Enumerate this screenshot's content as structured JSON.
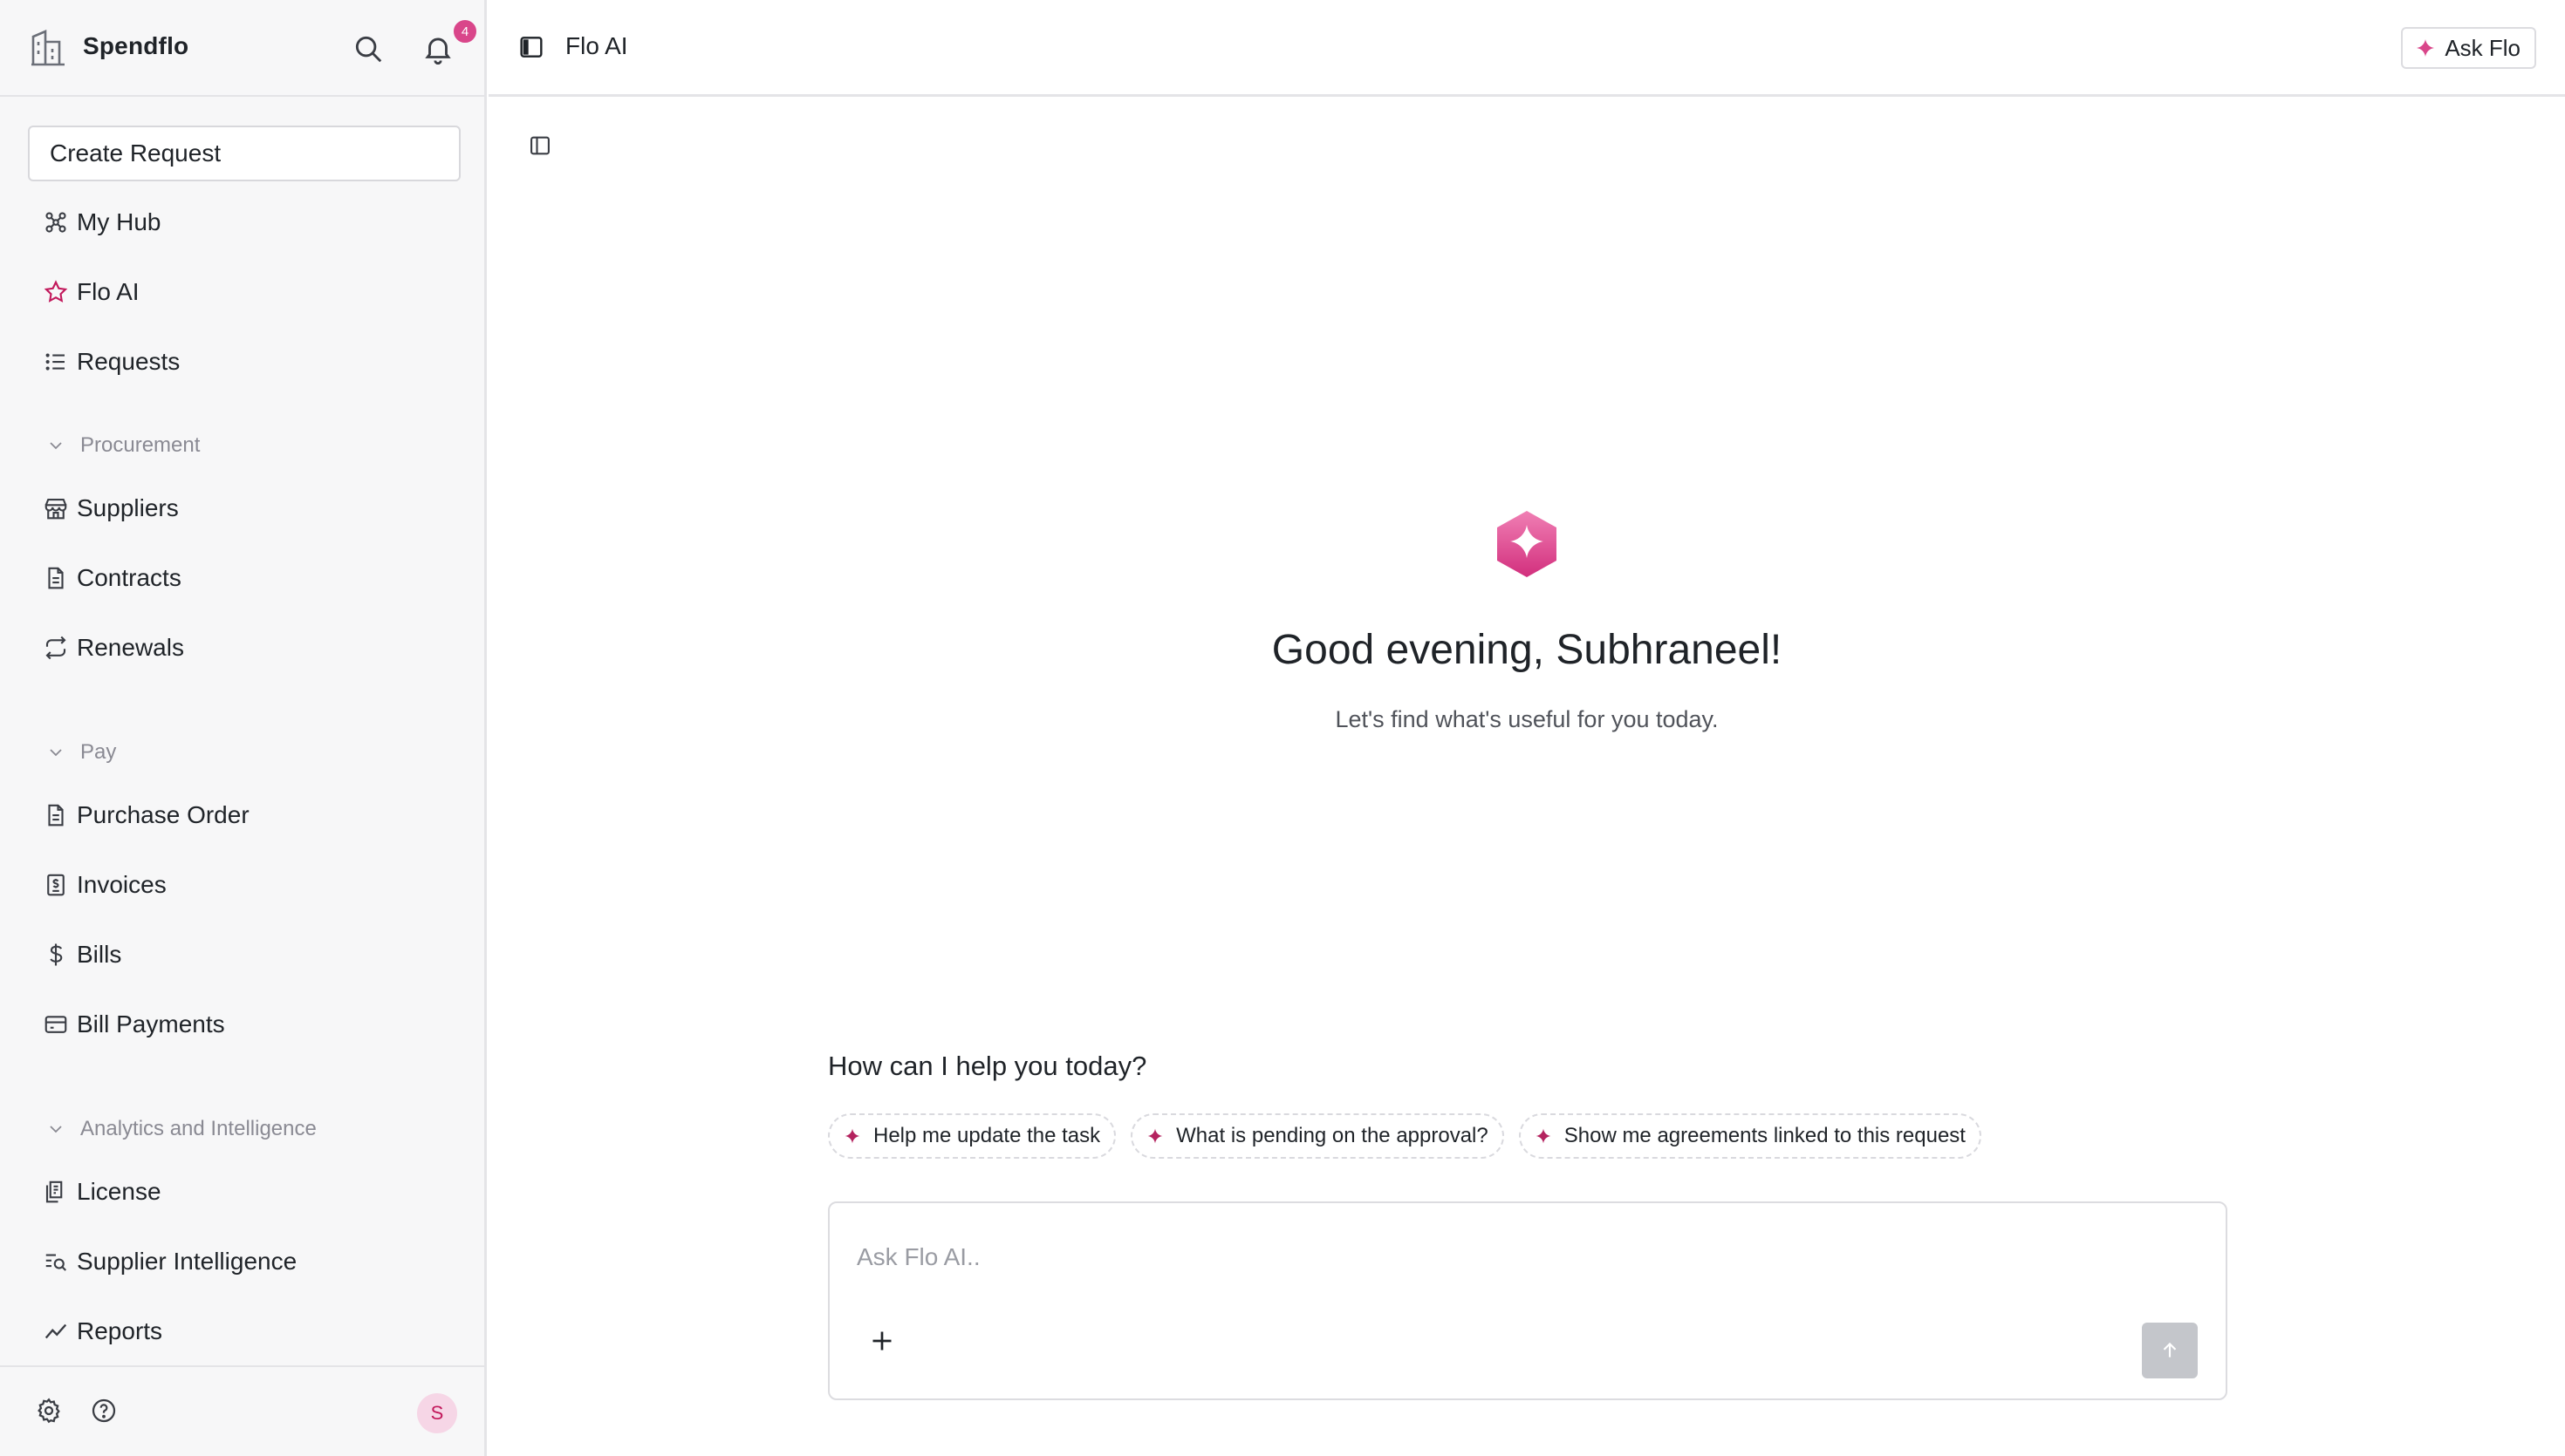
{
  "sidebar": {
    "brand": "Spendflo",
    "notification_count": "4",
    "create_request_label": "Create Request",
    "top_items": [
      {
        "label": "My Hub",
        "icon": "hub-icon"
      },
      {
        "label": "Flo AI",
        "icon": "star-icon"
      },
      {
        "label": "Requests",
        "icon": "list-icon"
      }
    ],
    "sections": [
      {
        "title": "Procurement",
        "items": [
          {
            "label": "Suppliers",
            "icon": "store-icon"
          },
          {
            "label": "Contracts",
            "icon": "document-icon"
          },
          {
            "label": "Renewals",
            "icon": "repeat-icon"
          }
        ]
      },
      {
        "title": "Pay",
        "items": [
          {
            "label": "Purchase Order",
            "icon": "document-icon"
          },
          {
            "label": "Invoices",
            "icon": "receipt-icon"
          },
          {
            "label": "Bills",
            "icon": "dollar-icon"
          },
          {
            "label": "Bill Payments",
            "icon": "card-icon"
          }
        ]
      },
      {
        "title": "Analytics and Intelligence",
        "items": [
          {
            "label": "License",
            "icon": "license-icon"
          },
          {
            "label": "Supplier Intelligence",
            "icon": "search-list-icon"
          },
          {
            "label": "Reports",
            "icon": "trend-icon"
          }
        ]
      }
    ],
    "avatar_initial": "S"
  },
  "topbar": {
    "title": "Flo AI",
    "ask_flo_label": "Ask Flo"
  },
  "main": {
    "greeting": "Good evening, Subhraneel!",
    "subtitle": "Let's find what's useful for you today.",
    "help_heading": "How can I help you today?",
    "suggestions": [
      "Help me update the task",
      "What is pending on the approval?",
      "Show me agreements linked to this request"
    ],
    "composer_placeholder": "Ask Flo AI.."
  },
  "colors": {
    "accent": "#d9468a",
    "sidebar_bg": "#f7f7f8",
    "border": "#e4e4e7",
    "send_disabled": "#c4c6cb"
  }
}
